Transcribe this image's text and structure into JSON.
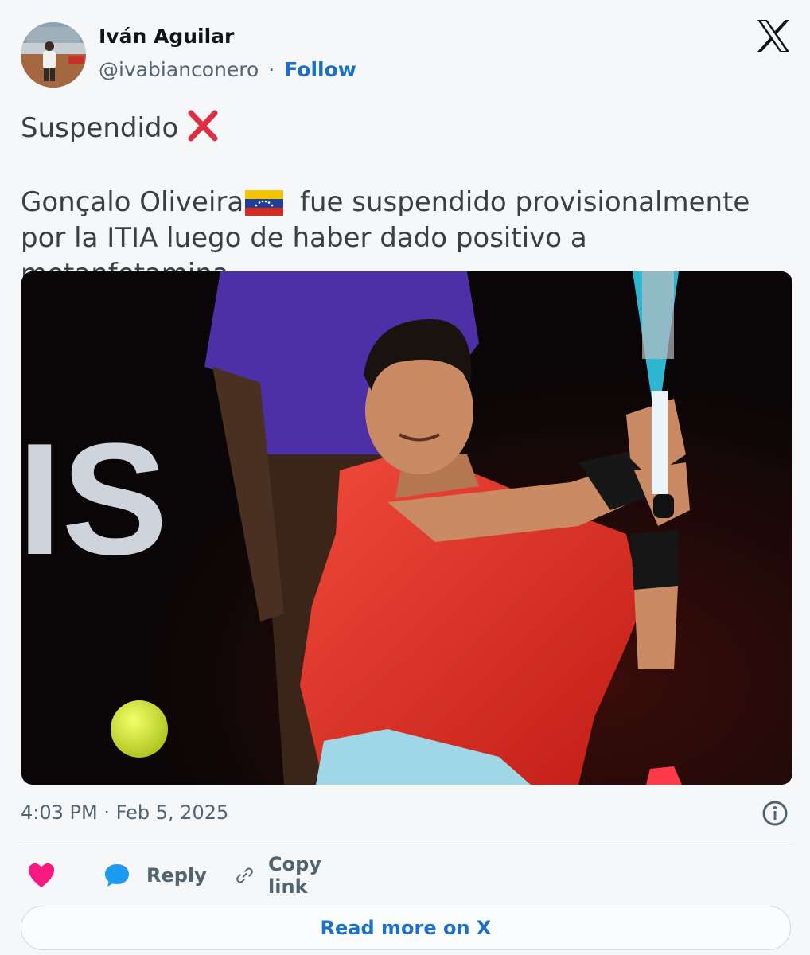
{
  "author": {
    "name": "Iván Aguilar",
    "handle": "@ivabianconero",
    "separator": "·",
    "follow_label": "Follow"
  },
  "brand": {
    "logo_icon": "x-logo-icon"
  },
  "tweet": {
    "line1": "Suspendido",
    "line1_emoji": "cross-mark-icon",
    "para_part1": "Gonçalo Oliveira",
    "para_flag": "venezuela-flag-icon",
    "para_part2": " fue suspendido provisionalmente por la ITIA luego de haber dado positivo a metanfetamina"
  },
  "media": {
    "watermark_text": "IS"
  },
  "meta": {
    "timestamp": "4:03 PM · Feb 5, 2025",
    "info_icon": "info-icon"
  },
  "actions": {
    "like_icon": "heart-icon",
    "reply_label": "Reply",
    "reply_icon": "speech-bubble-icon",
    "copy_label": "Copy link",
    "copy_icon": "link-icon"
  },
  "read_more": {
    "label": "Read more on X"
  },
  "colors": {
    "link_blue": "#1d6fc7",
    "heart_pink": "#f91880",
    "reply_blue": "#1d9bf0",
    "muted": "#536471"
  }
}
